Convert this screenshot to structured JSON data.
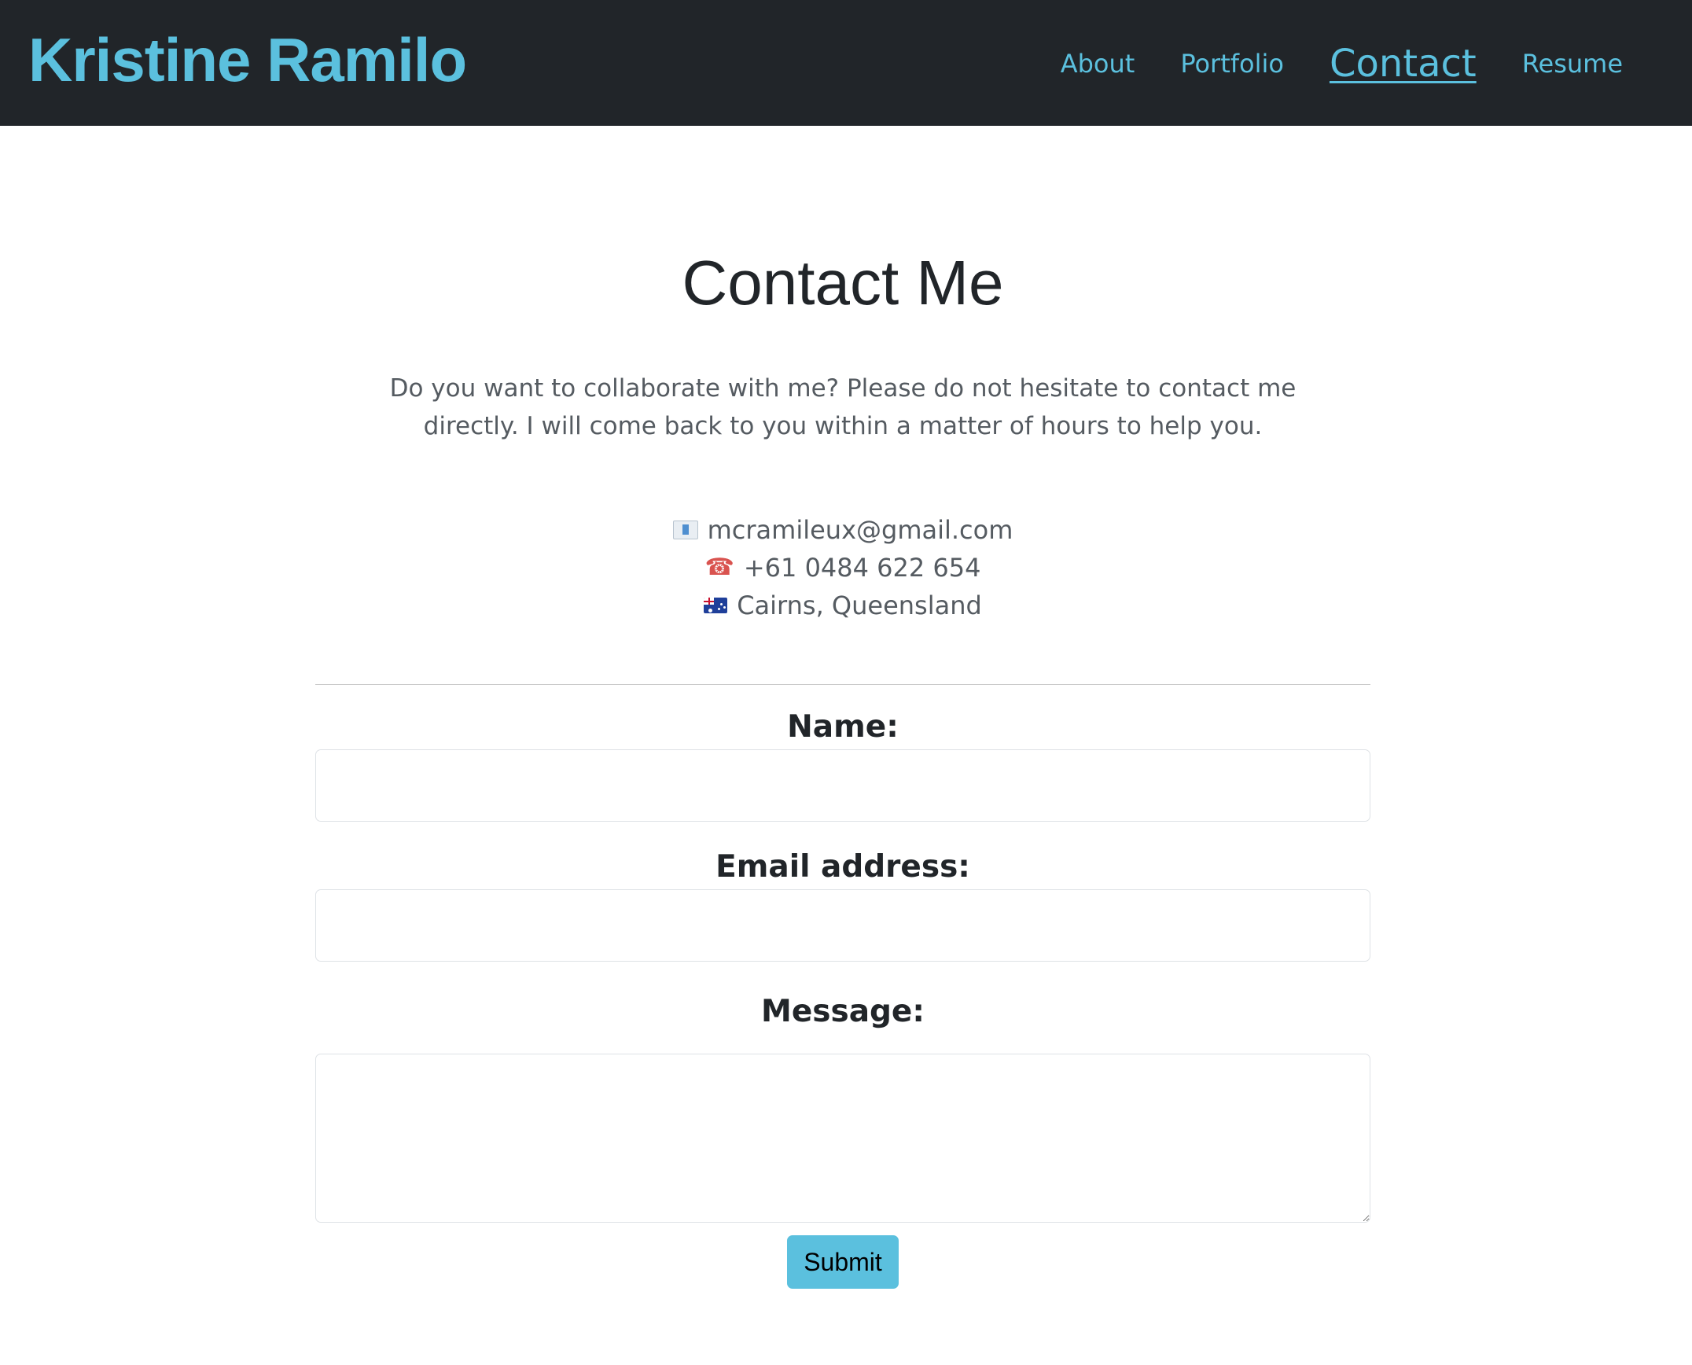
{
  "navbar": {
    "brand": "Kristine Ramilo",
    "links": [
      {
        "label": "About",
        "active": false
      },
      {
        "label": "Portfolio",
        "active": false
      },
      {
        "label": "Contact",
        "active": true
      },
      {
        "label": "Resume",
        "active": false
      }
    ]
  },
  "main": {
    "title": "Contact Me",
    "intro": "Do you want to collaborate with me? Please do not hesitate to contact me directly. I will come back to you within a matter of hours to help you.",
    "contact": {
      "email": {
        "icon": "envelope-icon",
        "text": "mcramileux@gmail.com"
      },
      "phone": {
        "icon": "telephone-icon",
        "text": "+61 0484 622 654"
      },
      "location": {
        "icon": "australia-flag-icon",
        "text": "Cairns, Queensland"
      }
    }
  },
  "form": {
    "name_label": "Name:",
    "name_value": "",
    "email_label": "Email address:",
    "email_value": "",
    "message_label": "Message:",
    "message_value": "",
    "submit_label": "Submit"
  },
  "colors": {
    "navbar_bg": "#212529",
    "accent": "#5bc0de",
    "text_dark": "#212529",
    "text_muted": "#555b61"
  }
}
